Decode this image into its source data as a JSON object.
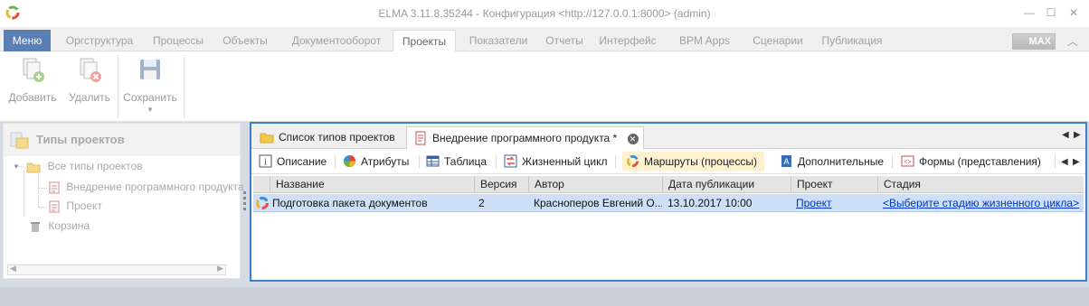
{
  "window": {
    "title": "ELMA 3.11.8.35244 - Конфигурация <http://127.0.0.1:8000> (admin)",
    "controls": {
      "minimize": "—",
      "maximize": "☐",
      "close": "✕"
    }
  },
  "ribbon": {
    "menu_label": "Меню",
    "tabs": [
      {
        "label": "Оргструктура"
      },
      {
        "label": "Процессы"
      },
      {
        "label": "Объекты"
      },
      {
        "label": "Документооборот"
      },
      {
        "label": "Проекты"
      },
      {
        "label": "Показатели"
      },
      {
        "label": "Отчеты"
      },
      {
        "label": "Интерфейс"
      },
      {
        "label": "BPM Apps"
      },
      {
        "label": "Сценарии"
      },
      {
        "label": "Публикация"
      }
    ],
    "active_tab": "Проекты",
    "badge": "MAX",
    "buttons": {
      "add": "Добавить",
      "delete": "Удалить",
      "save": "Сохранить"
    }
  },
  "left_panel": {
    "title": "Типы проектов",
    "tree": {
      "root": "Все типы проектов",
      "children": [
        "Внедрение программного продукта",
        "Проект"
      ],
      "trash": "Корзина"
    }
  },
  "doc_tabs": [
    {
      "label": "Список типов проектов"
    },
    {
      "label": "Внедрение программного продукта *"
    }
  ],
  "sub_tabs": [
    {
      "label": "Описание"
    },
    {
      "label": "Атрибуты"
    },
    {
      "label": "Таблица"
    },
    {
      "label": "Жизненный цикл"
    },
    {
      "label": "Маршруты (процессы)"
    },
    {
      "label": "Дополнительные"
    },
    {
      "label": "Формы (представления)"
    }
  ],
  "grid": {
    "columns": [
      "Название",
      "Версия",
      "Автор",
      "Дата публикации",
      "Проект",
      "Стадия"
    ],
    "rows": [
      {
        "name": "Подготовка пакета документов",
        "version": "2",
        "author": "Красноперов Евгений О...",
        "date": "13.10.2017 10:00",
        "project": "Проект",
        "stage": "<Выберите стадию жизненного цикла>"
      }
    ]
  },
  "colors": {
    "menu_button": "#5a7fb5",
    "panel_border": "#3c7fc8",
    "selected_row": "#cde0f7",
    "active_subtab": "#fdf1cf",
    "link": "#0033cc"
  }
}
